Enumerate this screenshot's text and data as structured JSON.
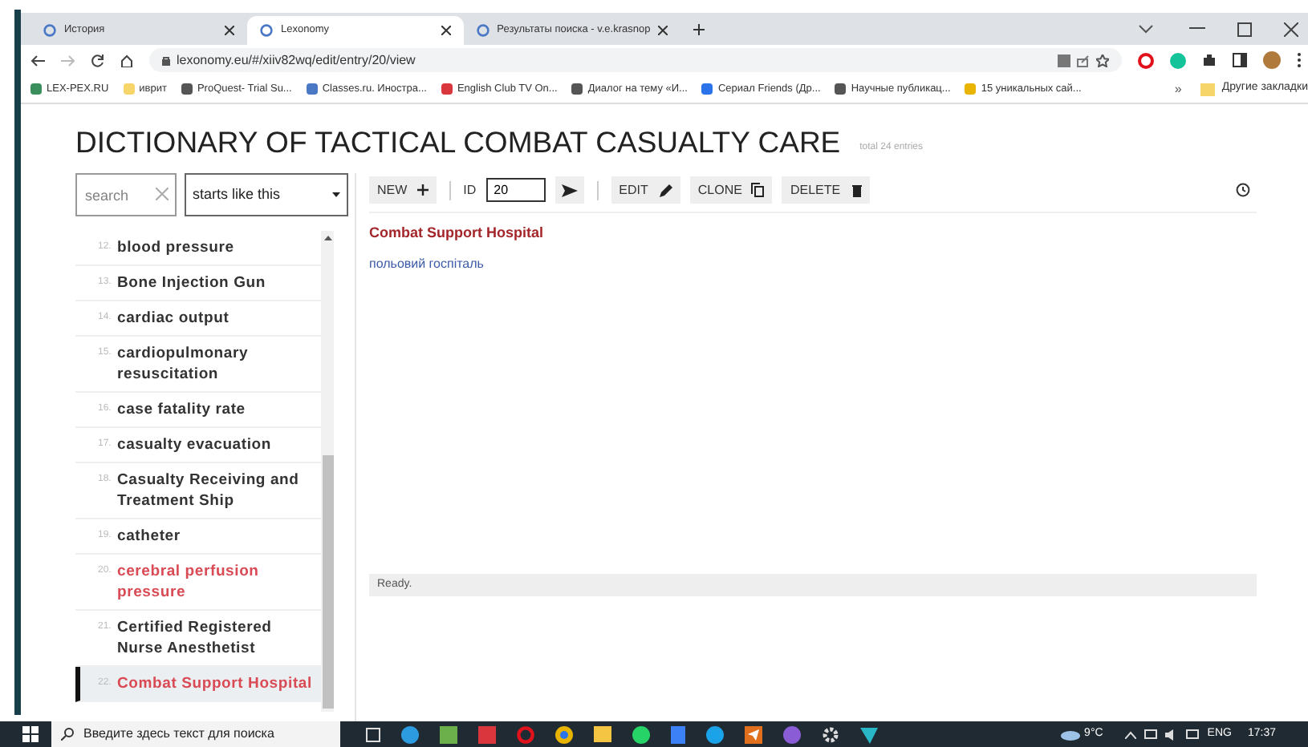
{
  "browser": {
    "tabs": [
      {
        "label": "История",
        "selected": false
      },
      {
        "label": "Lexonomy",
        "selected": true
      },
      {
        "label": "Результаты поиска - v.e.krasnop",
        "selected": false
      }
    ],
    "url": "lexonomy.eu/#/xiiv82wq/edit/entry/20/view",
    "bookmarks": [
      "LEX-PEX.RU",
      "иврит",
      "ProQuest- Trial Su...",
      "Classes.ru. Иностра...",
      "English Club TV On...",
      "Диалог на тему «И...",
      "Сериал Friends (Др...",
      "Научные публикац...",
      "15 уникальных сай..."
    ],
    "more_bookmarks": "»",
    "other_bookmarks": "Другие закладки"
  },
  "dictionary": {
    "title": "DICTIONARY OF TACTICAL COMBAT CASUALTY CARE",
    "total": "total 24 entries"
  },
  "search": {
    "placeholder": "search",
    "mode": "starts like this"
  },
  "entries": [
    {
      "number": "12.",
      "headword": "blood pressure",
      "flagged": false,
      "selected": false
    },
    {
      "number": "13.",
      "headword": "Bone Injection Gun",
      "flagged": false,
      "selected": false
    },
    {
      "number": "14.",
      "headword": "cardiac output",
      "flagged": false,
      "selected": false
    },
    {
      "number": "15.",
      "headword": "cardiopulmonary resuscitation",
      "flagged": false,
      "selected": false
    },
    {
      "number": "16.",
      "headword": "case fatality rate",
      "flagged": false,
      "selected": false
    },
    {
      "number": "17.",
      "headword": "casualty evacuation",
      "flagged": false,
      "selected": false
    },
    {
      "number": "18.",
      "headword": "Casualty Receiving and Treatment Ship",
      "flagged": false,
      "selected": false
    },
    {
      "number": "19.",
      "headword": "catheter",
      "flagged": false,
      "selected": false
    },
    {
      "number": "20.",
      "headword": "cerebral perfusion pressure",
      "flagged": true,
      "selected": false
    },
    {
      "number": "21.",
      "headword": "Certified Registered Nurse Anesthetist",
      "flagged": false,
      "selected": false
    },
    {
      "number": "22.",
      "headword": "Combat Support Hospital",
      "flagged": true,
      "selected": true
    }
  ],
  "toolbar": {
    "new": "NEW",
    "id_label": "ID",
    "id_value": "20",
    "edit": "EDIT",
    "clone": "CLONE",
    "delete": "DELETE"
  },
  "entry": {
    "headword": "Combat Support Hospital",
    "translation": "польовий госпіталь"
  },
  "status": "Ready.",
  "taskbar": {
    "search_placeholder": "Введите здесь текст для поиска",
    "temperature": "9°C",
    "language": "ENG",
    "time": "17:37"
  }
}
